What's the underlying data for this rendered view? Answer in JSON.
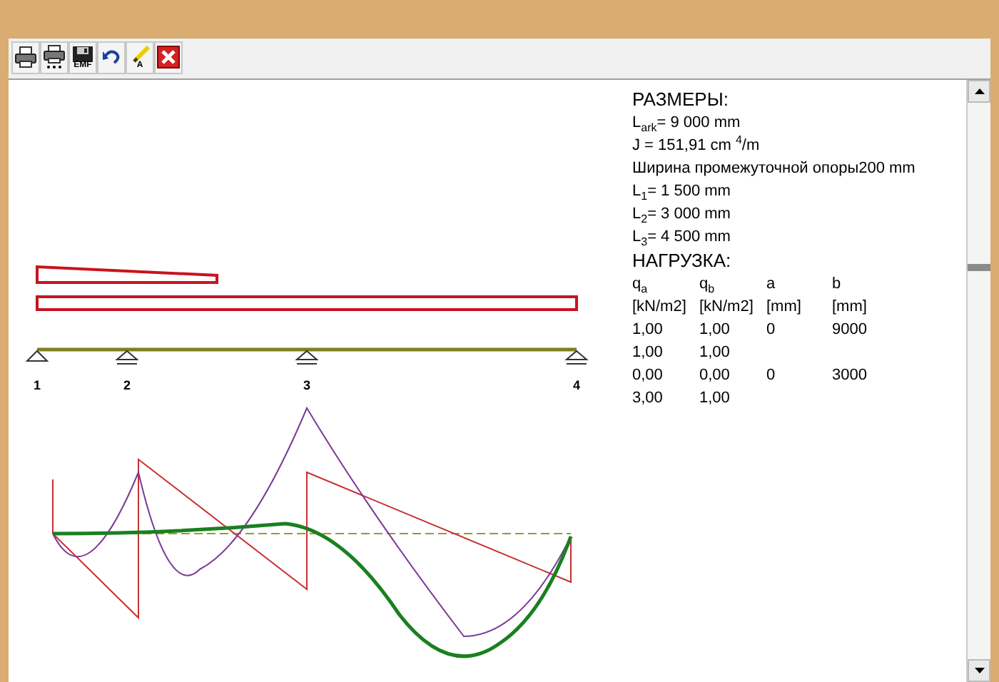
{
  "toolbar": [
    {
      "kind": "print"
    },
    {
      "kind": "print-setup"
    },
    {
      "kind": "save",
      "label": "EMF"
    },
    {
      "kind": "undo"
    },
    {
      "kind": "marker",
      "label": "A"
    },
    {
      "kind": "close"
    }
  ],
  "diagram": {
    "supports": [
      "1",
      "2",
      "3",
      "4"
    ]
  },
  "info": {
    "dimensions_heading": "РАЗМЕРЫ:",
    "dimension_lines": [
      "L$_{ark}$= 9 000 mm",
      "J =   151,91 cm $^{4}$/m",
      "Ширина промежуточной опоры200 mm",
      "L$_{1}$= 1 500 mm",
      "L$_{2}$= 3 000 mm",
      "L$_{3}$= 4 500 mm"
    ],
    "load_heading": "НАГРУЗКА:",
    "load_table": {
      "columns": [
        "q$_{a}$",
        "q$_{b}$",
        "a",
        "b"
      ],
      "units": [
        "[kN/m2]",
        "[kN/m2]",
        "[mm]",
        "[mm]"
      ],
      "rows": [
        [
          "1,00",
          "1,00",
          "0",
          "9000"
        ],
        [
          "1,00",
          "1,00"
        ],
        [
          "0,00",
          "0,00",
          "0",
          "3000"
        ],
        [
          "3,00",
          "1,00"
        ]
      ]
    }
  }
}
